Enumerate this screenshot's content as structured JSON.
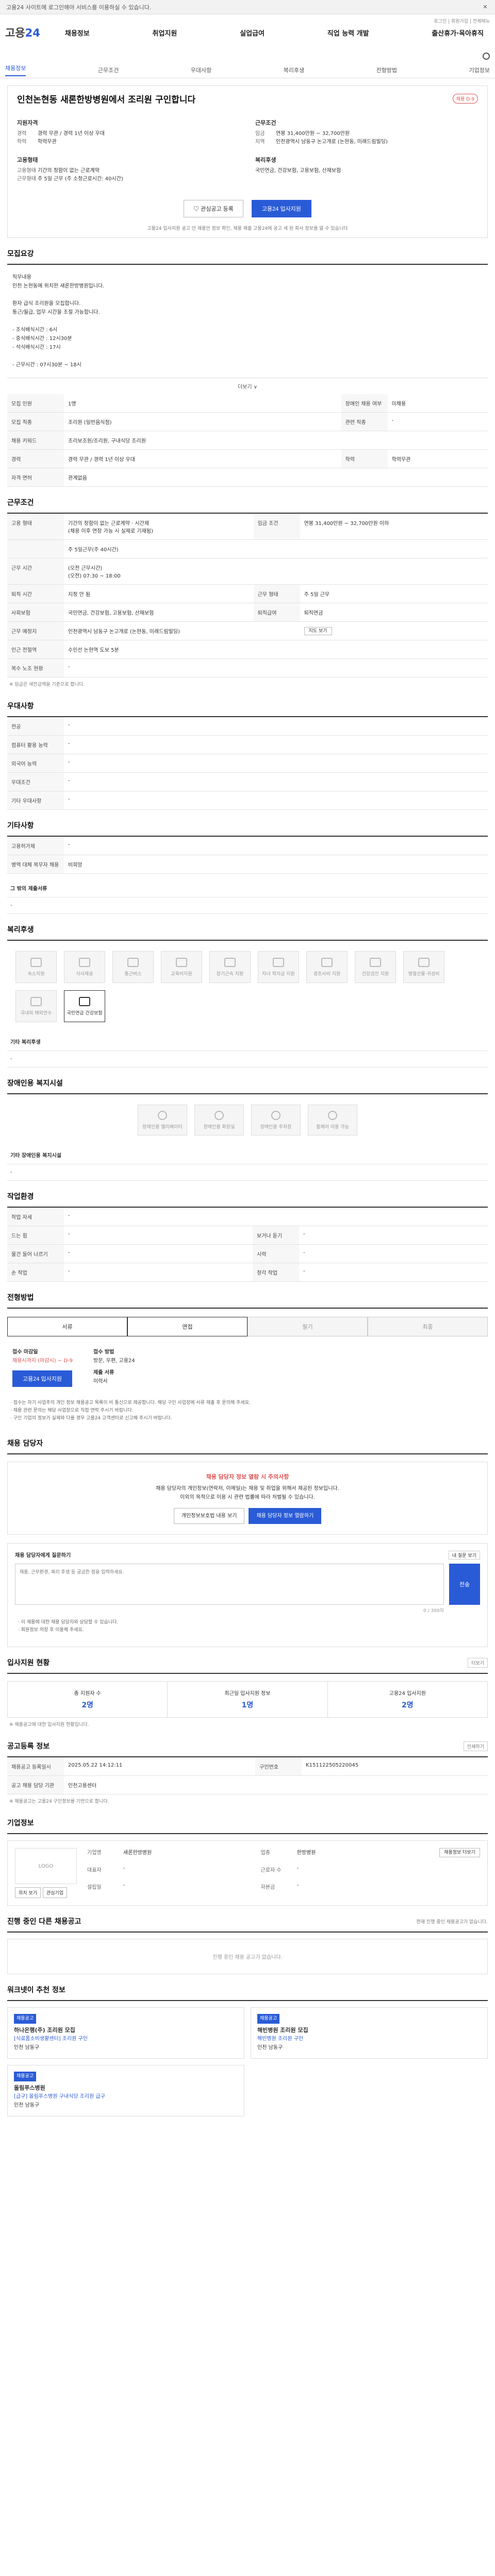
{
  "notice": "고용24 사이트에 로그인해야 서비스를 이용하실 수 있습니다.",
  "header": {
    "logo_prefix": "고용",
    "logo_num": "24",
    "nav": [
      "채용정보",
      "취업지원",
      "실업급여",
      "직업 능력 개발",
      "출산휴가·육아휴직"
    ],
    "top_links": "로그인 | 회원가입 | 전체메뉴"
  },
  "tabs": [
    "채용정보",
    "근무조건",
    "우대사항",
    "복리후생",
    "전형방법",
    "기업정보"
  ],
  "job": {
    "title": "인천논현동 새론한방병원에서 조리원 구인합니다",
    "badge": "채용 D-9",
    "req_title": "지원자격",
    "req": [
      {
        "k": "경력",
        "v": "경력 무관 / 경력 1년 이상 우대"
      },
      {
        "k": "학력",
        "v": "학력무관"
      }
    ],
    "cond_title": "근무조건",
    "cond": [
      {
        "k": "임금",
        "v": "연봉 31,400만원 ~ 32,700만원"
      },
      {
        "k": "지역",
        "v": "인천광역시 남동구 논고개로 (논현동, 미래드림빌딩)"
      }
    ],
    "type_title": "고용형태",
    "type": [
      {
        "k": "고용형태",
        "v": "기간의 정함이 없는 근로계약"
      },
      {
        "k": "근무형태",
        "v": "주 5일 근무 (주 소정근로시간: 40시간)"
      }
    ],
    "benefit_title": "복리후생",
    "benefit": [
      {
        "k": "",
        "v": "국민연금, 건강보험, 고용보험, 산재보험"
      }
    ],
    "btn_interest": "관심공고 등록",
    "btn_apply": "고용24 입사지원",
    "note": "고용24 입사지원 공고 안 채용안 정보 확인, 채용 제출 고용24에 공고 세 된 회사 정보를 알 수 있습니다"
  },
  "detail": {
    "title": "모집요강",
    "text": "직무내용\n인천 논현동에 위치한 새론한방병원입니다.\n\n 환자 급식 조리원을 모집합니다.\n 통근/월급, 업무 시간을 조절 가능합니다.\n\n - 조식배식시간 : 6시\n - 중식배식시간 : 12시30분\n - 석식배식시간 : 17시\n\n - 근무시간 : 07시30분 ~ 18시",
    "more": "더보기 ∨",
    "rows": [
      {
        "k": "모집 인원",
        "v": "1명",
        "k2": "장애인 채용 여부",
        "v2": "미채용"
      },
      {
        "k": "모집 직종",
        "v": "조리원 (일반음식점)",
        "k2": "관련 직종",
        "v2": "-"
      },
      {
        "k": "채용 키워드",
        "v": "조리보조원/조리원, 구내식당 조리원",
        "k2": "",
        "v2": ""
      },
      {
        "k": "경력",
        "v": "경력 무관 / 경력 1년 이상 우대",
        "k2": "학력",
        "v2": "학력무관"
      },
      {
        "k": "자격 면허",
        "v": "관계없음",
        "k2": "",
        "v2": ""
      }
    ]
  },
  "conditions": {
    "title": "근무조건",
    "rows": [
      {
        "k": "고용 형태",
        "v": "기간의 정함이 없는 근로계약 · 시간제\n(채용 이후 연장 가능 시 실제로 기재됨)",
        "k2": "임금 조건",
        "v2": "연봉 31,400만원 ~ 32,700만원 이하"
      },
      {
        "k": "",
        "v": "주 5일근무(주 40시간)",
        "k2": "",
        "v2": ""
      },
      {
        "k": "근무 시간",
        "v": "(오전 근무시간)\n(오전) 07:30 ~ 18:00",
        "k2": "",
        "v2": ""
      },
      {
        "k": "퇴직 시간",
        "v": "지정 안 됨",
        "k2": "근무 형태",
        "v2": "주 5일 근무"
      },
      {
        "k": "사회보험",
        "v": "국민연금, 건강보험, 고용보험, 산재보험",
        "k2": "퇴직급여",
        "v2": "퇴직연금"
      },
      {
        "k": "근무 예정지",
        "v": "인천광역시 남동구 논고개로 (논현동, 미래드림빌딩)",
        "k2": "",
        "v2": ""
      },
      {
        "k": "인근 전철역",
        "v": "수인선 논현역 도보 5분",
        "k2": "",
        "v2": ""
      },
      {
        "k": "복수 노조 현황",
        "v": "-",
        "k2": "",
        "v2": ""
      }
    ],
    "map_btn": "지도 보기",
    "note": "※ 임금은 세전금액을 기준으로 합니다."
  },
  "preference": {
    "title": "우대사항",
    "rows": [
      {
        "k": "전공",
        "v": "-"
      },
      {
        "k": "컴퓨터 활용 능력",
        "v": "-"
      },
      {
        "k": "외국어 능력",
        "v": "-"
      },
      {
        "k": "우대조건",
        "v": "-"
      },
      {
        "k": "기타 우대사항",
        "v": "-"
      }
    ]
  },
  "etc": {
    "title": "기타사항",
    "rows": [
      {
        "k": "고용허가제",
        "v": "-"
      },
      {
        "k": "병역 대체 복무자 채용",
        "v": "비희망"
      }
    ],
    "files_title": "그 밖의 제출서류",
    "files": "-"
  },
  "welfare": {
    "title": "복리후생",
    "items": [
      "숙소지원",
      "식사제공",
      "통근버스",
      "교육비지원",
      "장기근속 지원",
      "자녀 학자금 지원",
      "경조사비 지원",
      "건강검진 지원",
      "명절선물·귀성비",
      "국내외 해외연수",
      "국민연금 건강보험"
    ],
    "active": 10,
    "other_title": "기타 복리후생",
    "other": "-"
  },
  "disability": {
    "title": "장애인용 복지시설",
    "items": [
      "장애인용 엘리베이터",
      "장애인용 화장실",
      "장애인용 주차장",
      "휠체어 이용 가능"
    ],
    "other_title": "기타 장애인용 복지시설",
    "other": "-"
  },
  "environment": {
    "title": "작업환경",
    "rows": [
      {
        "k": "작업 자세",
        "v": "-",
        "k2": "",
        "v2": ""
      },
      {
        "k": "드는 힘",
        "v": "-",
        "k2": "보거나 듣기",
        "v2": "-"
      },
      {
        "k": "물건 들어 나르기",
        "v": "-",
        "k2": "시력",
        "v2": "-"
      },
      {
        "k": "손 작업",
        "v": "-",
        "k2": "청각 작업",
        "v2": "-"
      }
    ]
  },
  "selection": {
    "title": "전형방법",
    "steps": [
      "서류",
      "면접",
      "필기",
      "최종"
    ],
    "active_steps": [
      0,
      1
    ],
    "deadline_k": "접수 마감일",
    "deadline_v": "채용시까지 (마감시) ~ D-9",
    "method_k": "접수 방법",
    "method_v": "방문, 우편, 고용24",
    "docs_k": "제출 서류",
    "docs_v": "이력서",
    "apply_btn": "고용24 입사지원",
    "bullets": [
      "· 접수는 자기 사업주의 개인 정보 채용공고 목록이 비 통신으로 제공합니다. 해당 구인 사업장에 서류 제출 후 문의해 주세요.",
      "· 채용 관련 문의는 해당 사업장으로 직접 연락 주시기 바랍니다.",
      "· 구인 기업의 정보가 실제와 다를 경우 고용24 고객센터로 신고해 주시기 바랍니다."
    ]
  },
  "contact": {
    "title": "채용 담당자",
    "alert_title": "채용 담당자 정보 열람 시 주의사항",
    "alert_body": "채용 담당자의 개인정보(연락처, 이메일)는 채용 및 취업을 위해서 제공된 정보입니다.\n이외의 목적으로 이용 시 관련 법률에 따라 처벌될 수 있습니다.",
    "btn_view": "개인정보보호법 내용 보기",
    "btn_check": "채용 담당자 정보 열람하기",
    "q_label": "채용 담당자에게 질문하기",
    "q_link": "내 질문 보기",
    "q_placeholder": "채용, 근무환경, 복리 후생 등 궁금한 점을 입력하세요.",
    "q_count": "0 / 300자",
    "q_send": "전송",
    "q_notes": [
      "· 이 채용에 대한 채용 담당자와 상담할 수 있습니다.",
      "· 회원정보 저장 후 이용해 주세요."
    ]
  },
  "apply_status": {
    "title": "입사지원 현황",
    "more": "더보기",
    "stats": [
      {
        "k": "총 지원자 수",
        "v": "2명"
      },
      {
        "k": "최근일 입사지원 정보",
        "v": "1명"
      },
      {
        "k": "고용24 입사지원",
        "v": "2명"
      }
    ],
    "note": "※ 채용공고에 대한 입사지원 현황입니다."
  },
  "reg_info": {
    "title": "공고등록 정보",
    "btn": "인쇄하기",
    "rows": [
      {
        "k": "채용공고 등록일시",
        "v": "2025.05.22 14:12:11",
        "k2": "구인번호",
        "v2": "K151122505220045"
      },
      {
        "k": "공고 채용 담당 기관",
        "v": "인천고용센터",
        "k2": "",
        "v2": ""
      }
    ],
    "note": "※ 채용공고는 고용24 구인정보를 기반으로 합니다."
  },
  "company": {
    "title": "기업정보",
    "logo": "LOGO",
    "btn": "채용정보 더보기",
    "rows": [
      {
        "k": "기업명",
        "v": "새론한방병원",
        "k2": "업종",
        "v2": "한방병원"
      },
      {
        "k": "대표자",
        "v": "-",
        "k2": "근로자 수",
        "v2": "-"
      },
      {
        "k": "설립일",
        "v": "-",
        "k2": "자본금",
        "v2": "-"
      }
    ],
    "loc_btn": "위치 보기",
    "fav_btn": "관심기업"
  },
  "other_jobs": {
    "title": "진행 중인 다른 채용공고",
    "sub": "현재 진행 중인 채용공고가 없습니다.",
    "empty": "진행 중인 채용 공고가 없습니다."
  },
  "recommend": {
    "title": "워크넷이 추천 정보",
    "items": [
      {
        "tag": "채용공고",
        "title": "하나은행(주) 조리원 모집",
        "line": "[식료품소비생활센터] 조리원 구인",
        "loc": "인천 남동구"
      },
      {
        "tag": "채용공고",
        "title": "해빈병원 조리원 모집",
        "line": "해빈병원 조리원 구인",
        "loc": "인천 남동구"
      },
      {
        "tag": "채용공고",
        "title": "올림푸스병원",
        "line": "[급구] 올림푸스병원 구내식당 조리원 급구",
        "loc": "인천 남동구"
      }
    ]
  }
}
